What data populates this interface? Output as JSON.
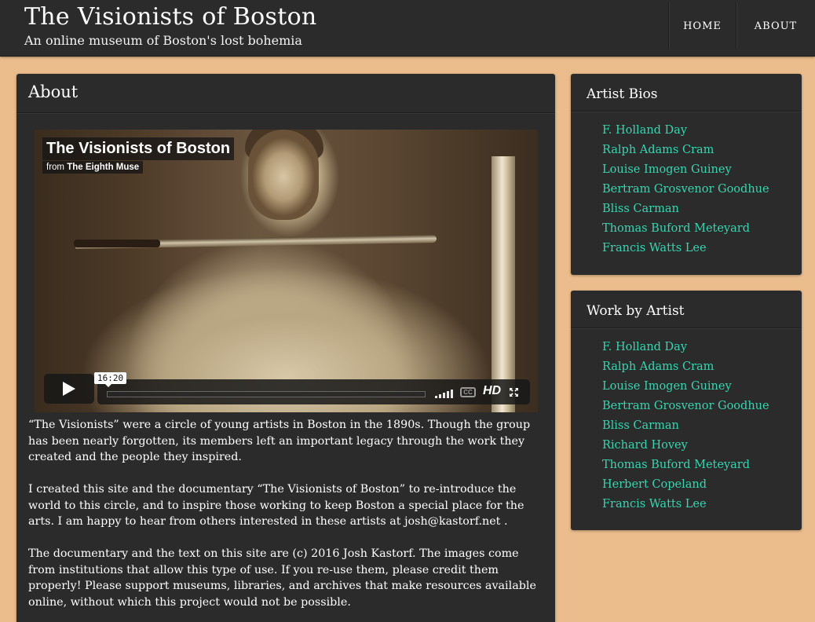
{
  "header": {
    "title": "The Visionists of Boston",
    "subtitle": "An online museum of Boston's lost bohemia",
    "nav": [
      {
        "label": "HOME"
      },
      {
        "label": "ABOUT"
      }
    ]
  },
  "main": {
    "title": "About",
    "video": {
      "title": "The Visionists of Boston",
      "from_prefix": "from",
      "from_channel": "The Eighth Muse",
      "duration": "16:20",
      "hd_label": "HD",
      "cc_label": "CC",
      "progress": 0
    },
    "paragraphs": [
      "“The Visionists” were a circle of young artists in Boston in the 1890s.  Though the group has been nearly forgotten, its members left an important legacy through the work they created and the people they inspired.",
      "I created this site and the documentary “The Visionists of Boston” to re-introduce the world to this circle, and to inspire those working to keep Boston a special place for the arts.  I am happy to hear from others interested in these artists at josh@kastorf.net .",
      "The documentary and the text on this site are (c) 2016 Josh Kastorf.  The images come from institutions that allow this type of use.  If you re-use them, please credit them properly!  Please support museums, libraries, and archives that make resources available online, without which this project would not be possible."
    ]
  },
  "sidebar": {
    "bios": {
      "title": "Artist Bios",
      "items": [
        "F. Holland Day",
        "Ralph Adams Cram",
        "Louise Imogen Guiney",
        "Bertram Grosvenor Goodhue",
        "Bliss Carman",
        "Thomas Buford Meteyard",
        "Francis Watts Lee"
      ]
    },
    "works": {
      "title": "Work by Artist",
      "items": [
        "F. Holland Day",
        "Ralph Adams Cram",
        "Louise Imogen Guiney",
        "Bertram Grosvenor Goodhue",
        "Bliss Carman",
        "Richard Hovey",
        "Thomas Buford Meteyard",
        "Herbert Copeland",
        "Francis Watts Lee"
      ]
    }
  },
  "colors": {
    "page_background": "#ebbd8c",
    "panel_background": "#2b2b2b",
    "link": "#35d6b0"
  }
}
